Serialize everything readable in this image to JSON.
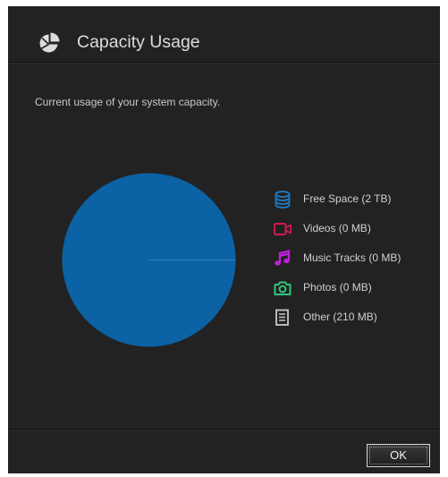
{
  "dialog": {
    "title": "Capacity Usage",
    "description": "Current usage of your system capacity."
  },
  "chart_data": {
    "type": "pie",
    "categories": [
      "Free Space",
      "Videos",
      "Music Tracks",
      "Photos",
      "Other"
    ],
    "values": [
      2000000,
      0,
      0,
      0,
      210
    ],
    "unit": "MB"
  },
  "legend": {
    "items": [
      {
        "label": "Free Space (2 TB)",
        "icon": "database-icon",
        "color": "#1e7bc4"
      },
      {
        "label": "Videos (0 MB)",
        "icon": "video-camera-icon",
        "color": "#d4184f"
      },
      {
        "label": "Music Tracks (0 MB)",
        "icon": "music-note-icon",
        "color": "#c21ee0"
      },
      {
        "label": "Photos (0 MB)",
        "icon": "camera-icon",
        "color": "#31c47a"
      },
      {
        "label": "Other (210 MB)",
        "icon": "document-icon",
        "color": "#c8c8c8"
      }
    ]
  },
  "colors": {
    "pie_fill": "#0b62a4",
    "pie_divider": "#3b8fd6",
    "dialog_bg": "#222222"
  },
  "footer": {
    "ok_label": "OK"
  }
}
